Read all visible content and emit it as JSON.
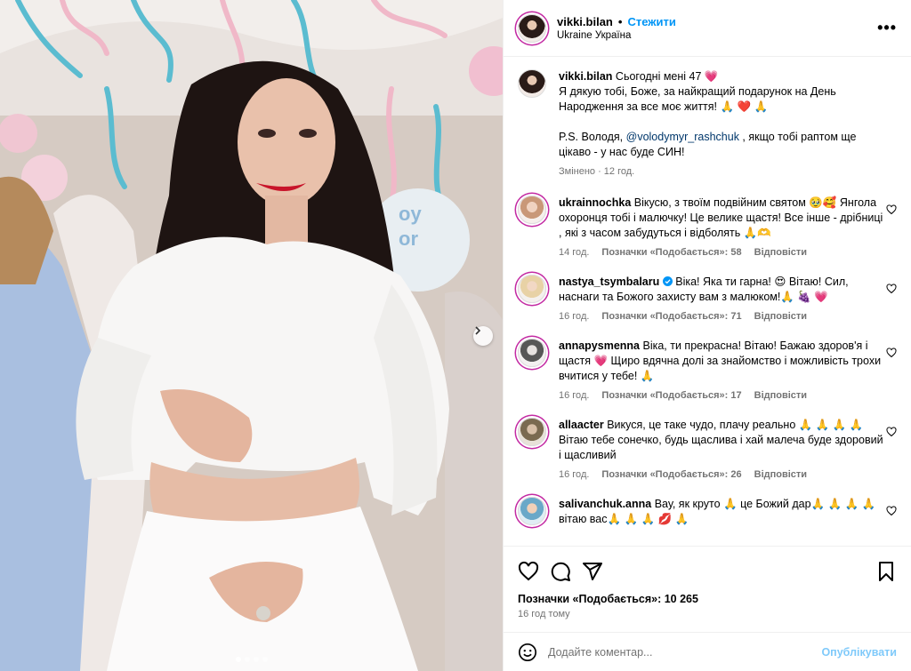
{
  "post": {
    "author": "vikki.bilan",
    "follow_label": "Стежити",
    "separator": "•",
    "location": "Ukraine Україна",
    "more_icon": "more-horizontal-icon",
    "carousel_dots": 4,
    "carousel_active": 0
  },
  "caption": {
    "username": "vikki.bilan",
    "line1": " Сьогодні мені 47 💗",
    "line2": "Я дякую тобі, Боже, за найкращий подарунок на День Народження за все моє життя! 🙏 ❤️ 🙏",
    "line3a": "P.S. Володя, ",
    "mention": "@volodymyr_rashchuk",
    "line3b": " , якщо тобі раптом ще цікаво - у нас буде СИН!",
    "edited": "Змінено · 12 год."
  },
  "comments": [
    {
      "username": "ukrainnochka",
      "text": "Вікусю, з твоїм подвійним святом 🥹🥰 Янгола охоронця тобі і малючку! Це велике щастя! Все інше - дрібниці , які з часом забудуться і відболять 🙏🫶",
      "time": "14 год.",
      "likes": "Позначки «Подобається»: 58",
      "reply": "Відповісти",
      "verified": false
    },
    {
      "username": "nastya_tsymbalaru",
      "text": "Віка! Яка ти гарна! 😍 Вітаю! Сил, наснаги та Божого захисту вам з малюком!🙏 🍇 💗",
      "time": "16 год.",
      "likes": "Позначки «Подобається»: 71",
      "reply": "Відповісти",
      "verified": true
    },
    {
      "username": "annapysmenna",
      "text": "Віка, ти прекрасна! Вітаю! Бажаю здоров'я і щастя 💗 Щиро вдячна долі за знайомство і можливість трохи вчитися у тебе! 🙏",
      "time": "16 год.",
      "likes": "Позначки «Подобається»: 17",
      "reply": "Відповісти",
      "verified": false
    },
    {
      "username": "allaacter",
      "text": "Викуся, це таке чудо, плачу реально 🙏 🙏 🙏 🙏 Вітаю тебе сонечко, будь щаслива і хай малеча буде здоровий і щасливий",
      "time": "16 год.",
      "likes": "Позначки «Подобається»: 26",
      "reply": "Відповісти",
      "verified": false
    },
    {
      "username": "salivanchuk.anna",
      "text": "Вау, як круто 🙏 це Божий дар🙏 🙏 🙏 🙏 вітаю вас🙏 🙏 🙏 💋 🙏",
      "time": "",
      "likes": "",
      "reply": "",
      "verified": false
    }
  ],
  "actions": {
    "like_icon": "heart-icon",
    "comment_icon": "comment-icon",
    "share_icon": "share-icon",
    "save_icon": "bookmark-icon",
    "likes": "Позначки «Подобається»: 10 265",
    "ago": "16 год тому"
  },
  "add_comment": {
    "emoji_icon": "emoji-icon",
    "placeholder": "Додайте коментар...",
    "post_label": "Опублікувати"
  },
  "colors": {
    "link": "#00376b",
    "accent": "#0095f6",
    "muted": "#737373"
  }
}
